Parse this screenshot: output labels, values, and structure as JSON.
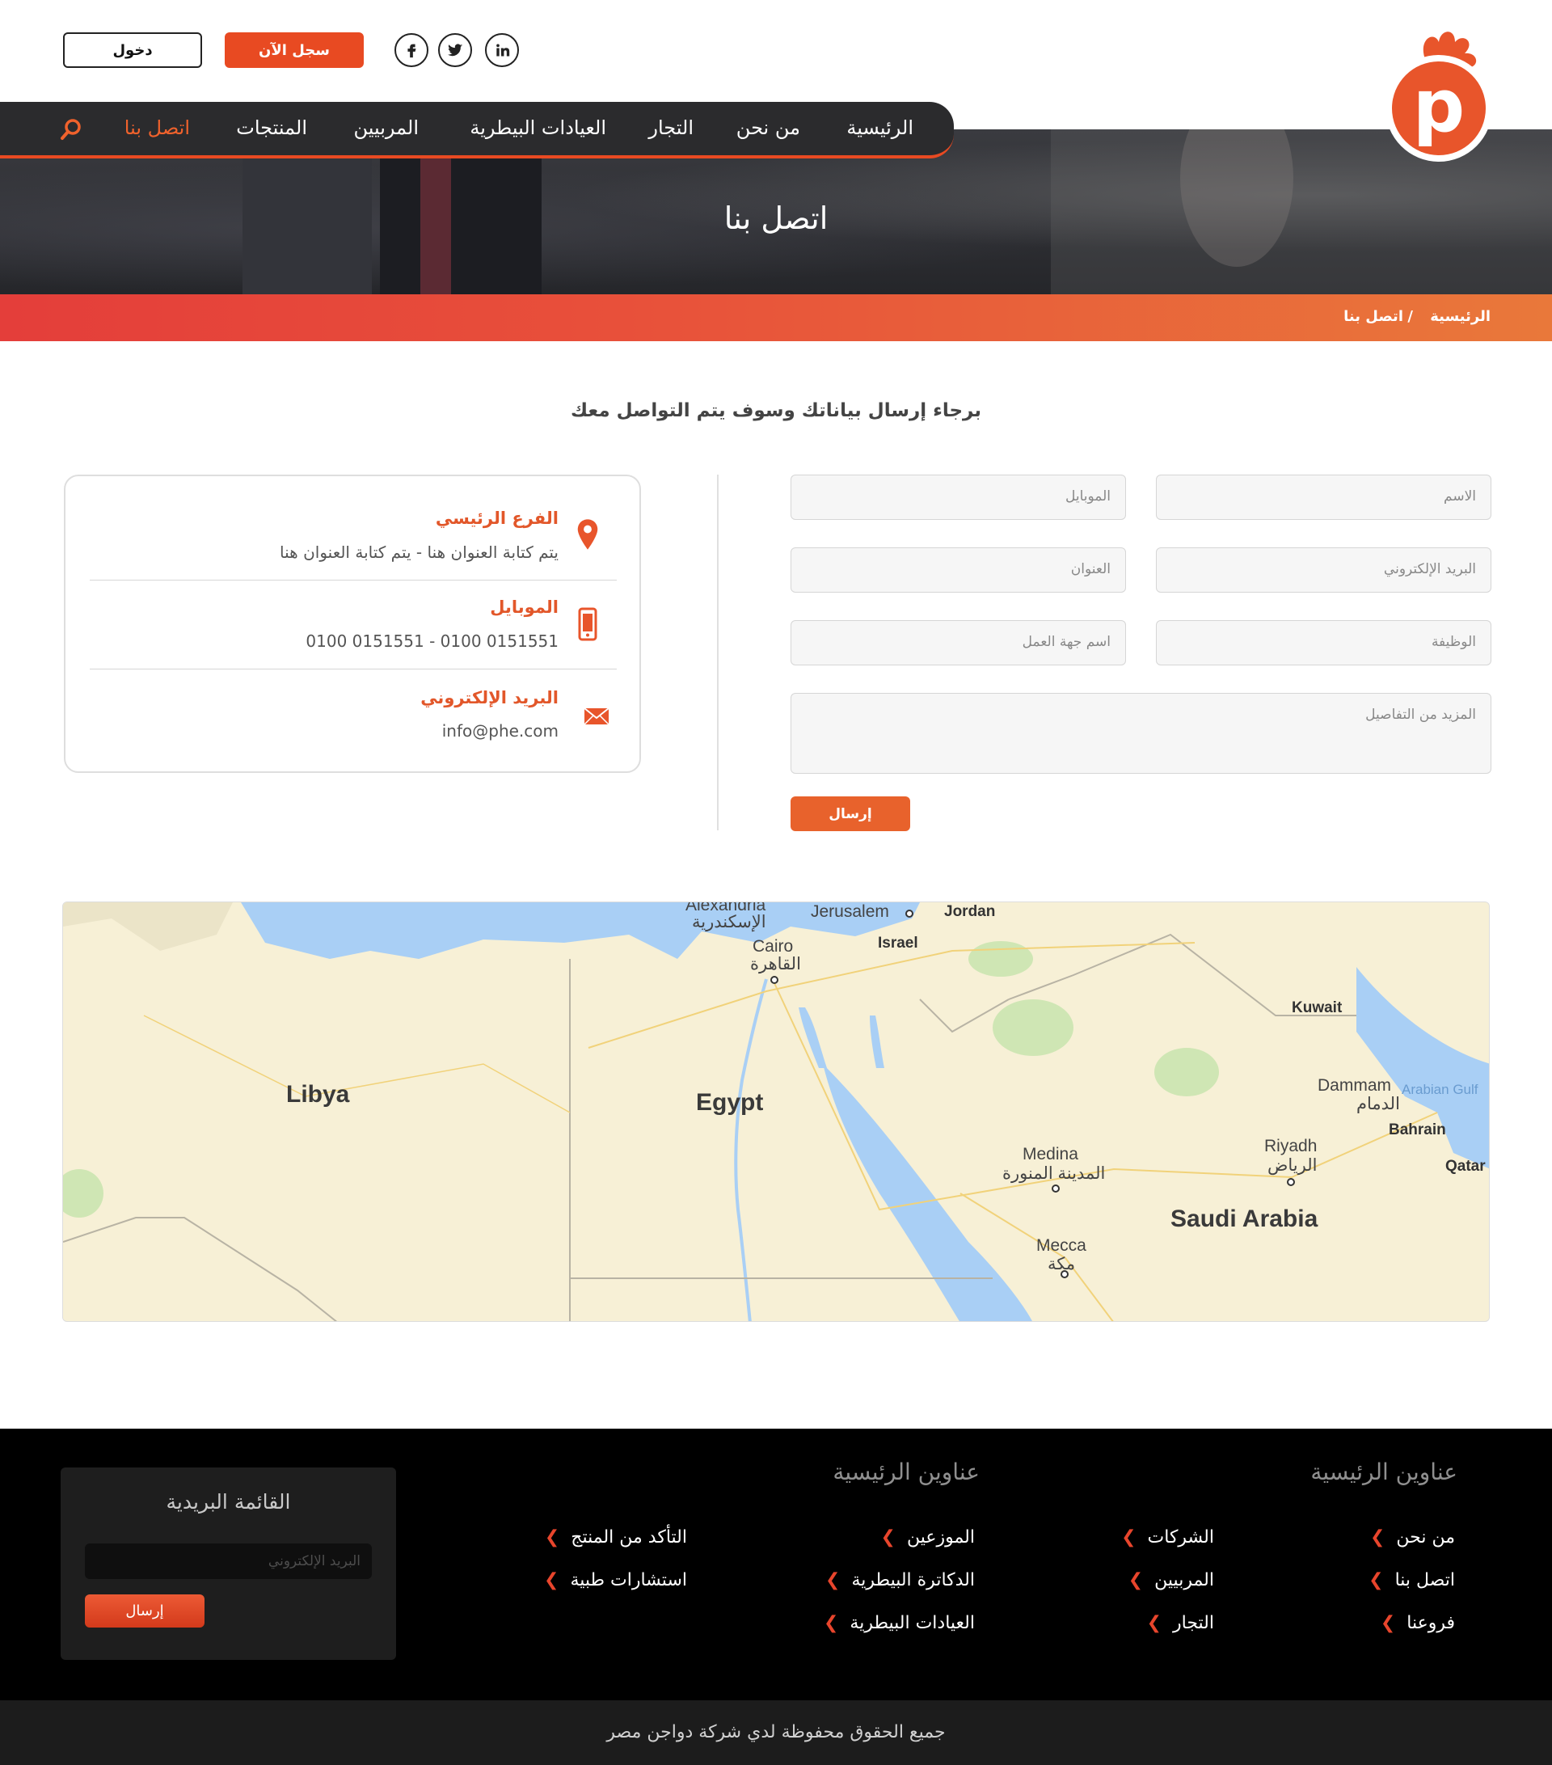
{
  "header": {
    "login_label": "دخول",
    "register_label": "سجل الآن",
    "social": [
      "facebook-icon",
      "twitter-icon",
      "linkedin-icon"
    ],
    "brand_letter": "p",
    "brand_color": "#e8552b"
  },
  "nav": {
    "items": [
      "الرئيسية",
      "من نحن",
      "التجار",
      "العيادات البيطرية",
      "المربيين",
      "المنتجات",
      "اتصل بنا"
    ],
    "active_index": 6,
    "active_color": "#f0622c"
  },
  "hero": {
    "title": "اتصل بنا"
  },
  "breadcrumb": {
    "home": "الرئيسية",
    "separator": "/",
    "current": "اتصل بنا"
  },
  "contact": {
    "intro": "برجاء إرسال بياناتك وسوف يتم التواصل معك",
    "fields": {
      "name": "الاسم",
      "mobile": "الموبايل",
      "email": "البريد الإلكتروني",
      "address": "العنوان",
      "job": "الوظيفة",
      "employer": "اسم جهة العمل",
      "details": "المزيد من التفاصيل"
    },
    "submit_label": "إرسال"
  },
  "info": {
    "branch_title": "الفرع الرئيسي",
    "branch_text": "يتم كتابة العنوان هنا - يتم كتابة العنوان هنا",
    "mobile_title": "الموبايل",
    "mobile_text": "0100 0151551   -   0100 0151551",
    "email_title": "البريد الإلكتروني",
    "email_text": "info@phe.com"
  },
  "map": {
    "labels": {
      "alexandria": "Alexandria",
      "alexandria_ar": "الإسكندرية",
      "cairo": "Cairo",
      "cairo_ar": "القاهرة",
      "jerusalem": "Jerusalem",
      "jordan": "Jordan",
      "israel": "Israel",
      "kuwait": "Kuwait",
      "libya": "Libya",
      "egypt": "Egypt",
      "dammam": "Dammam",
      "dammam_ar": "الدمام",
      "arabian_gulf": "Arabian Gulf",
      "bahrain": "Bahrain",
      "qatar": "Qatar",
      "riyadh": "Riyadh",
      "riyadh_ar": "الرياض",
      "medina": "Medina",
      "medina_ar": "المدينة المنورة",
      "saudi": "Saudi Arabia",
      "mecca": "Mecca",
      "mecca_ar": "مكة"
    }
  },
  "footer": {
    "col1_heading": "عناوين الرئيسية",
    "col1_links": [
      "من نحن",
      "اتصل بنا",
      "فروعنا"
    ],
    "col2_links": [
      "الشركات",
      "المربيين",
      "التجار"
    ],
    "col3_heading": "عناوين الرئيسية",
    "col3_links": [
      "الموزعين",
      "الدكاترة البيطرية",
      "العيادات البيطرية"
    ],
    "col4_links": [
      "التأكد من المنتج",
      "استشارات طبية"
    ],
    "newsletter_title": "القائمة البريدية",
    "newsletter_placeholder": "البريد الإلكتروني",
    "newsletter_button": "إرسال",
    "copyright": "جميع الحقوق محفوظة لدي شركة دواجن مصر"
  }
}
